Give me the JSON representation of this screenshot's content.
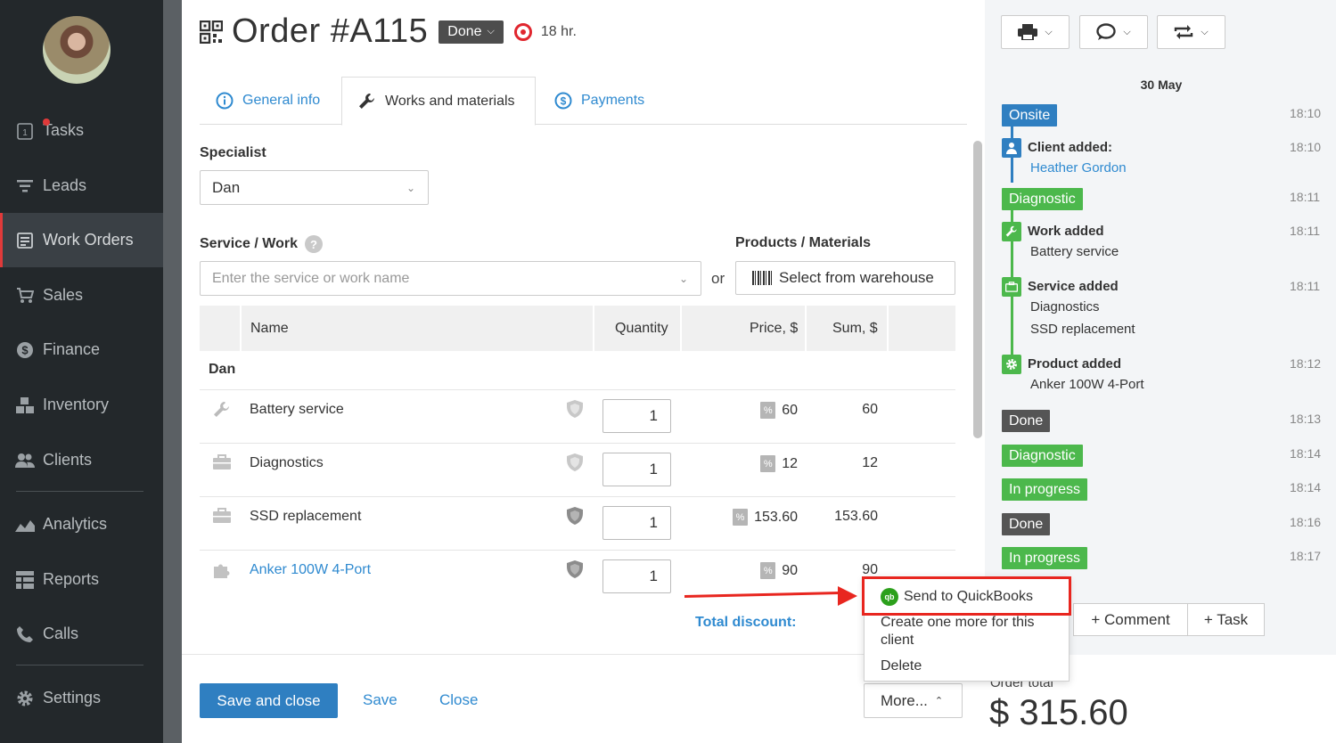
{
  "sidebar": {
    "items": [
      {
        "label": "Tasks",
        "icon": "tasks-icon",
        "badge": "1"
      },
      {
        "label": "Leads",
        "icon": "leads-icon"
      },
      {
        "label": "Work Orders",
        "icon": "work-orders-icon",
        "active": true
      },
      {
        "label": "Sales",
        "icon": "cart-icon"
      },
      {
        "label": "Finance",
        "icon": "dollar-icon"
      },
      {
        "label": "Inventory",
        "icon": "inventory-icon"
      },
      {
        "label": "Clients",
        "icon": "clients-icon"
      },
      {
        "label": "Analytics",
        "icon": "analytics-icon"
      },
      {
        "label": "Reports",
        "icon": "reports-icon"
      },
      {
        "label": "Calls",
        "icon": "phone-icon"
      },
      {
        "label": "Settings",
        "icon": "gear-icon"
      }
    ]
  },
  "order": {
    "title": "Order #A115",
    "status": "Done",
    "hours": "18 hr."
  },
  "tabs": [
    {
      "label": "General info",
      "icon": "info-icon"
    },
    {
      "label": "Works and materials",
      "icon": "wrench-icon",
      "active": true
    },
    {
      "label": "Payments",
      "icon": "dollar-circle-icon"
    }
  ],
  "form": {
    "specialist_label": "Specialist",
    "specialist_value": "Dan",
    "service_label": "Service / Work",
    "service_placeholder": "Enter the service or work name",
    "or_text": "or",
    "products_label": "Products / Materials",
    "warehouse_button": "Select from warehouse"
  },
  "table": {
    "headers": {
      "name": "Name",
      "quantity": "Quantity",
      "price": "Price, $",
      "sum": "Sum, $"
    },
    "group": "Dan",
    "rows": [
      {
        "name": "Battery service",
        "qty": "1",
        "price": "60",
        "sum": "60",
        "icon": "wrench-icon"
      },
      {
        "name": "Diagnostics",
        "qty": "1",
        "price": "12",
        "sum": "12",
        "icon": "briefcase-icon"
      },
      {
        "name": "SSD replacement",
        "qty": "1",
        "price": "153.60",
        "sum": "153.60",
        "icon": "briefcase-icon"
      },
      {
        "name": "Anker 100W 4-Port",
        "qty": "1",
        "price": "90",
        "sum": "90",
        "icon": "puzzle-icon"
      }
    ],
    "total_discount_label": "Total discount:"
  },
  "footer": {
    "save_close": "Save and close",
    "save": "Save",
    "close": "Close",
    "more": "More..."
  },
  "more_menu": {
    "items": [
      "Send to QuickBooks",
      "Create one more for this client",
      "Delete"
    ],
    "qb_logo_text": "qb"
  },
  "timeline": {
    "date": "30 May",
    "events": [
      {
        "type": "badge",
        "label": "Onsite",
        "time": "18:10",
        "color": "#2f7fc1"
      },
      {
        "type": "event",
        "title": "Client added:",
        "sub": [
          "Heather Gordon"
        ],
        "time": "18:10"
      },
      {
        "type": "badge",
        "label": "Diagnostic",
        "time": "18:11",
        "color": "#4cb84c"
      },
      {
        "type": "event",
        "title": "Work added",
        "sub": [
          "Battery service"
        ],
        "time": "18:11"
      },
      {
        "type": "event",
        "title": "Service added",
        "sub": [
          "Diagnostics",
          "SSD replacement"
        ],
        "time": "18:11"
      },
      {
        "type": "event",
        "title": "Product added",
        "sub": [
          "Anker 100W 4-Port"
        ],
        "time": "18:12"
      },
      {
        "type": "badge",
        "label": "Done",
        "time": "18:13",
        "color": "#555555"
      },
      {
        "type": "badge",
        "label": "Diagnostic",
        "time": "18:14",
        "color": "#4cb84c"
      },
      {
        "type": "badge",
        "label": "In progress",
        "time": "18:14",
        "color": "#4cb84c"
      },
      {
        "type": "badge",
        "label": "Done",
        "time": "18:16",
        "color": "#555555"
      },
      {
        "type": "badge",
        "label": "In progress",
        "time": "18:17",
        "color": "#4cb84c"
      }
    ],
    "comment_button": "+ Comment",
    "task_button": "+ Task"
  },
  "totals": {
    "label": "Order total",
    "value": "$ 315.60"
  },
  "colors": {
    "accent": "#2f7fc1",
    "link": "#2f8ad0",
    "highlight": "#e8261f",
    "sidebar_bg": "#23282b"
  }
}
